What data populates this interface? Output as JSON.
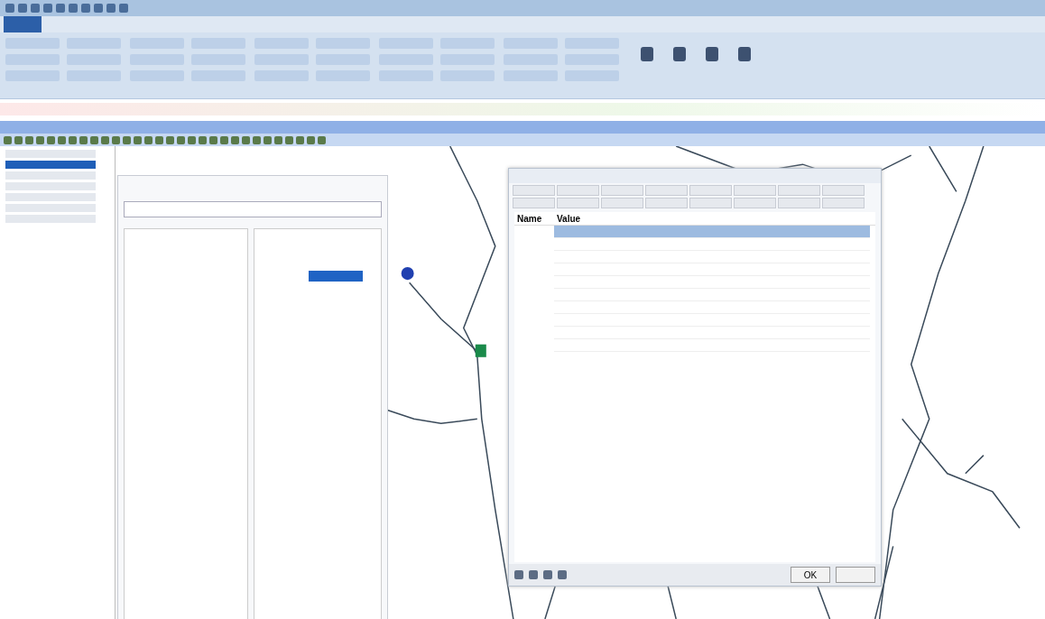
{
  "toc": {
    "items": [
      {
        "selected": false
      },
      {
        "selected": true
      },
      {
        "selected": false
      },
      {
        "selected": false
      },
      {
        "selected": false
      },
      {
        "selected": false
      },
      {
        "selected": false
      }
    ]
  },
  "attributes_dialog": {
    "columns": [
      "Name",
      "Value"
    ],
    "rows": [
      {
        "selected": true
      },
      {
        "selected": false
      },
      {
        "selected": false
      },
      {
        "selected": false
      },
      {
        "selected": false
      },
      {
        "selected": false
      },
      {
        "selected": false
      },
      {
        "selected": false
      },
      {
        "selected": false
      },
      {
        "selected": false
      }
    ],
    "buttons": [
      "OK"
    ]
  }
}
